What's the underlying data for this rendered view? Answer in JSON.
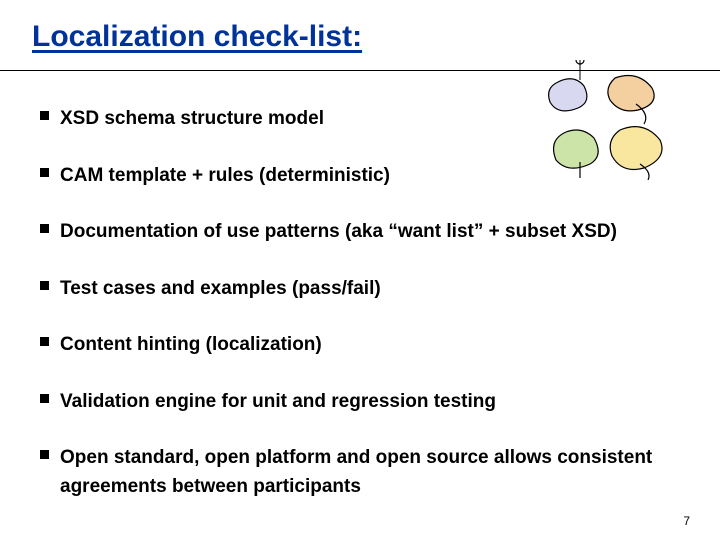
{
  "title": "Localization check-list:",
  "bullets": [
    "XSD schema structure model",
    "CAM template + rules (deterministic)",
    "Documentation of use patterns (aka “want list” + subset XSD)",
    "Test cases and examples (pass/fail)",
    "Content hinting (localization)",
    "Validation engine for unit and regression testing",
    "Open standard, open platform and open source allows consistent agreements between participants"
  ],
  "page_number": "7"
}
